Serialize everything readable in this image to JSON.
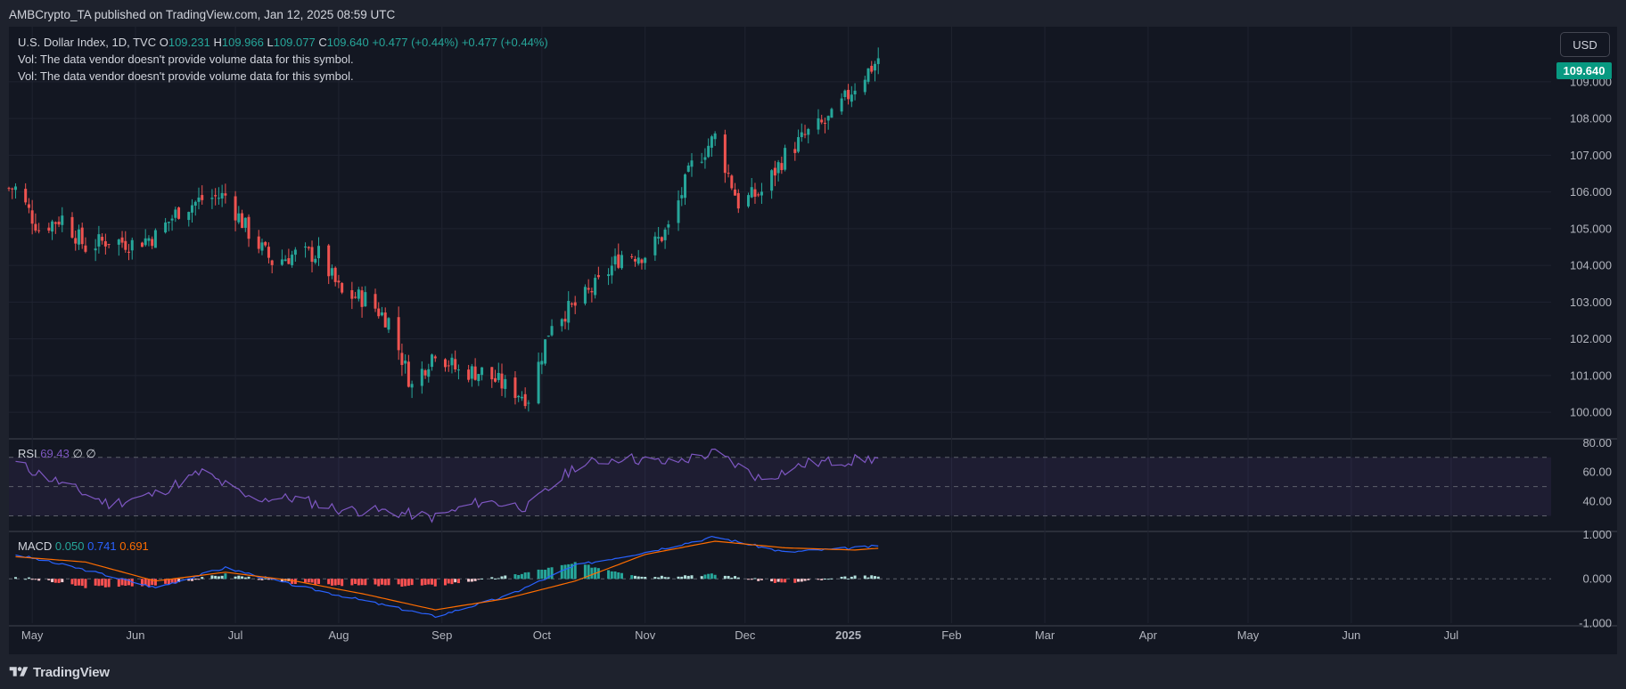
{
  "header": {
    "publisher_line": "AMBCrypto_TA published on TradingView.com, Jan 12, 2025 08:59 UTC"
  },
  "legend": {
    "symbol": "U.S. Dollar Index, 1D, TVC",
    "open_label": "O",
    "open": "109.231",
    "high_label": "H",
    "high": "109.966",
    "low_label": "L",
    "low": "109.077",
    "close_label": "C",
    "close": "109.640",
    "change": "+0.477 (+0.44%)",
    "change2": "+0.477 (+0.44%)",
    "vol_line_1": "Vol: The data vendor doesn't provide volume data for this symbol.",
    "vol_line_2": "Vol: The data vendor doesn't provide volume data for this symbol."
  },
  "controls": {
    "currency_button": "USD"
  },
  "last_price_tag": "109.640",
  "rsi_legend": {
    "label": "RSI",
    "value": "69.43",
    "extra": "∅ ∅"
  },
  "macd_legend": {
    "label": "MACD",
    "hist": "0.050",
    "macd": "0.741",
    "signal": "0.691"
  },
  "footer": {
    "brand": "TradingView"
  },
  "colors": {
    "up": "#26a69a",
    "down": "#ef5350",
    "rsi": "#7e57c2",
    "macd": "#2962ff",
    "signal": "#ff6d00",
    "price_tag": "#089981"
  },
  "chart_data": [
    {
      "type": "candlestick",
      "title": "U.S. Dollar Index, 1D, TVC",
      "y_axis_ticks": [
        "100.000",
        "101.000",
        "102.000",
        "103.000",
        "104.000",
        "105.000",
        "106.000",
        "107.000",
        "108.000",
        "109.000"
      ],
      "ylim": [
        99.3,
        110.5
      ],
      "x_axis_ticks": [
        "May",
        "Jun",
        "Jul",
        "Aug",
        "Sep",
        "Oct",
        "Nov",
        "Dec",
        "2025",
        "Feb",
        "Mar",
        "Apr",
        "May",
        "Jun",
        "Jul"
      ],
      "x_date_range": [
        "2024-04-24",
        "2025-07-31"
      ],
      "last_price": 109.64,
      "weekly_closes": [
        {
          "date": "2024-04-26",
          "close": 106.1
        },
        {
          "date": "2024-05-03",
          "close": 105.0
        },
        {
          "date": "2024-05-10",
          "close": 105.3
        },
        {
          "date": "2024-05-17",
          "close": 104.5
        },
        {
          "date": "2024-05-24",
          "close": 104.7
        },
        {
          "date": "2024-05-31",
          "close": 104.6
        },
        {
          "date": "2024-06-07",
          "close": 104.8
        },
        {
          "date": "2024-06-14",
          "close": 105.5
        },
        {
          "date": "2024-06-21",
          "close": 105.8
        },
        {
          "date": "2024-06-28",
          "close": 105.9
        },
        {
          "date": "2024-07-05",
          "close": 104.9
        },
        {
          "date": "2024-07-12",
          "close": 104.1
        },
        {
          "date": "2024-07-19",
          "close": 104.3
        },
        {
          "date": "2024-07-26",
          "close": 104.3
        },
        {
          "date": "2024-08-02",
          "close": 103.2
        },
        {
          "date": "2024-08-09",
          "close": 103.1
        },
        {
          "date": "2024-08-16",
          "close": 102.5
        },
        {
          "date": "2024-08-23",
          "close": 100.7
        },
        {
          "date": "2024-08-30",
          "close": 101.7
        },
        {
          "date": "2024-09-06",
          "close": 101.1
        },
        {
          "date": "2024-09-13",
          "close": 101.1
        },
        {
          "date": "2024-09-20",
          "close": 100.7
        },
        {
          "date": "2024-09-27",
          "close": 100.4
        },
        {
          "date": "2024-10-04",
          "close": 102.5
        },
        {
          "date": "2024-10-11",
          "close": 102.9
        },
        {
          "date": "2024-10-18",
          "close": 103.5
        },
        {
          "date": "2024-10-25",
          "close": 104.3
        },
        {
          "date": "2024-11-01",
          "close": 104.3
        },
        {
          "date": "2024-11-08",
          "close": 105.0
        },
        {
          "date": "2024-11-15",
          "close": 106.7
        },
        {
          "date": "2024-11-22",
          "close": 107.5
        },
        {
          "date": "2024-11-29",
          "close": 105.7
        },
        {
          "date": "2024-12-06",
          "close": 106.0
        },
        {
          "date": "2024-12-13",
          "close": 107.0
        },
        {
          "date": "2024-12-20",
          "close": 107.6
        },
        {
          "date": "2024-12-27",
          "close": 108.0
        },
        {
          "date": "2025-01-03",
          "close": 108.9
        },
        {
          "date": "2025-01-10",
          "close": 109.6
        }
      ]
    },
    {
      "type": "line",
      "title": "RSI",
      "y_axis_ticks": [
        "40.00",
        "60.00",
        "80.00"
      ],
      "ylim": [
        20,
        82
      ],
      "bands": [
        30,
        50,
        70
      ],
      "last_value": 69.43,
      "weekly_values": [
        {
          "date": "2024-04-26",
          "value": 66
        },
        {
          "date": "2024-05-10",
          "value": 52
        },
        {
          "date": "2024-05-24",
          "value": 38
        },
        {
          "date": "2024-06-07",
          "value": 45
        },
        {
          "date": "2024-06-21",
          "value": 60
        },
        {
          "date": "2024-07-05",
          "value": 42
        },
        {
          "date": "2024-07-19",
          "value": 42
        },
        {
          "date": "2024-08-02",
          "value": 34
        },
        {
          "date": "2024-08-16",
          "value": 33
        },
        {
          "date": "2024-08-30",
          "value": 29
        },
        {
          "date": "2024-09-13",
          "value": 40
        },
        {
          "date": "2024-09-27",
          "value": 36
        },
        {
          "date": "2024-10-11",
          "value": 64
        },
        {
          "date": "2024-10-25",
          "value": 70
        },
        {
          "date": "2024-11-08",
          "value": 66
        },
        {
          "date": "2024-11-22",
          "value": 73
        },
        {
          "date": "2024-12-06",
          "value": 55
        },
        {
          "date": "2024-12-20",
          "value": 66
        },
        {
          "date": "2025-01-03",
          "value": 68
        },
        {
          "date": "2025-01-10",
          "value": 69.43
        }
      ]
    },
    {
      "type": "line",
      "title": "MACD",
      "y_axis_ticks": [
        "-1.000",
        "0.000",
        "1.000"
      ],
      "ylim": [
        -1.0,
        1.05
      ],
      "last_values": {
        "histogram": 0.05,
        "macd": 0.741,
        "signal": 0.691
      },
      "weekly_values": [
        {
          "date": "2024-04-26",
          "macd": 0.55,
          "signal": 0.5
        },
        {
          "date": "2024-05-17",
          "macd": 0.2,
          "signal": 0.38
        },
        {
          "date": "2024-06-07",
          "macd": -0.2,
          "signal": -0.05
        },
        {
          "date": "2024-06-28",
          "macd": 0.25,
          "signal": 0.15
        },
        {
          "date": "2024-07-19",
          "macd": -0.15,
          "signal": -0.05
        },
        {
          "date": "2024-08-09",
          "macd": -0.5,
          "signal": -0.35
        },
        {
          "date": "2024-08-30",
          "macd": -0.85,
          "signal": -0.7
        },
        {
          "date": "2024-09-20",
          "macd": -0.4,
          "signal": -0.45
        },
        {
          "date": "2024-10-11",
          "macd": 0.3,
          "signal": -0.05
        },
        {
          "date": "2024-11-01",
          "macd": 0.6,
          "signal": 0.55
        },
        {
          "date": "2024-11-22",
          "macd": 0.95,
          "signal": 0.85
        },
        {
          "date": "2024-12-13",
          "macd": 0.6,
          "signal": 0.7
        },
        {
          "date": "2025-01-03",
          "macd": 0.7,
          "signal": 0.65
        },
        {
          "date": "2025-01-10",
          "macd": 0.741,
          "signal": 0.691
        }
      ]
    }
  ]
}
